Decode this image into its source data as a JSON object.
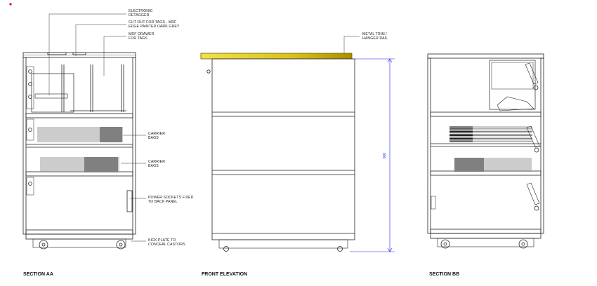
{
  "annotations": {
    "electronic_detagger": [
      "ELECTRONIC",
      "DETAGGER"
    ],
    "cut_out": [
      "CUT OUT FOR TAGS - MDF",
      "EDGE PAINTED DARK GREY"
    ],
    "mdf_drawer": [
      "MDF DRAWER",
      "FOR TAGS"
    ],
    "carrier_bags_1": [
      "CARRIER",
      "BAGS"
    ],
    "carrier_bags_2": [
      "CARRIER",
      "BAGS"
    ],
    "power_sockets": [
      "POWER SOCKETS FIXED",
      "TO BACK PANEL"
    ],
    "kick_plate": [
      "KICK PLATE TO",
      "CONCEAL CASTORS"
    ],
    "metal_trim": [
      "METAL TRIM /",
      "HANGER RAIL"
    ]
  },
  "dimension": "900",
  "titles": {
    "section_aa": "SECTION AA",
    "front_elevation": "FRONT ELEVATION",
    "section_bb": "SECTION BB"
  },
  "colors": {
    "line": "#222222",
    "trim_gold": "#c8b400",
    "dimension": "#1a1aff",
    "marker": "#e00000"
  }
}
